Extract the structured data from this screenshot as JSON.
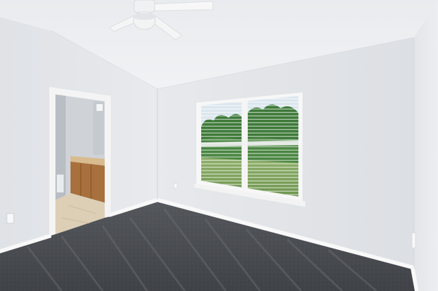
{
  "scene": {
    "kind": "photo",
    "subject": "empty-bedroom",
    "colors": {
      "wall": "#e6e8eb",
      "wall_shadow": "#d9dce0",
      "ceiling": "#eceef0",
      "carpet": "#4a4d52",
      "baseboard": "#f6f6f6",
      "door_trim": "#f3f3f3",
      "cabinet": "#b07a45",
      "countertop": "#d6b98f",
      "bath_floor": "#d8cbb3",
      "lawn": "#7fa35c",
      "trees": "#3f7a3a",
      "sky": "#d9e6f0"
    },
    "elements": [
      "ceiling-fan",
      "window-with-blinds",
      "bathroom-doorway",
      "carpet-floor",
      "wall-outlet"
    ]
  }
}
